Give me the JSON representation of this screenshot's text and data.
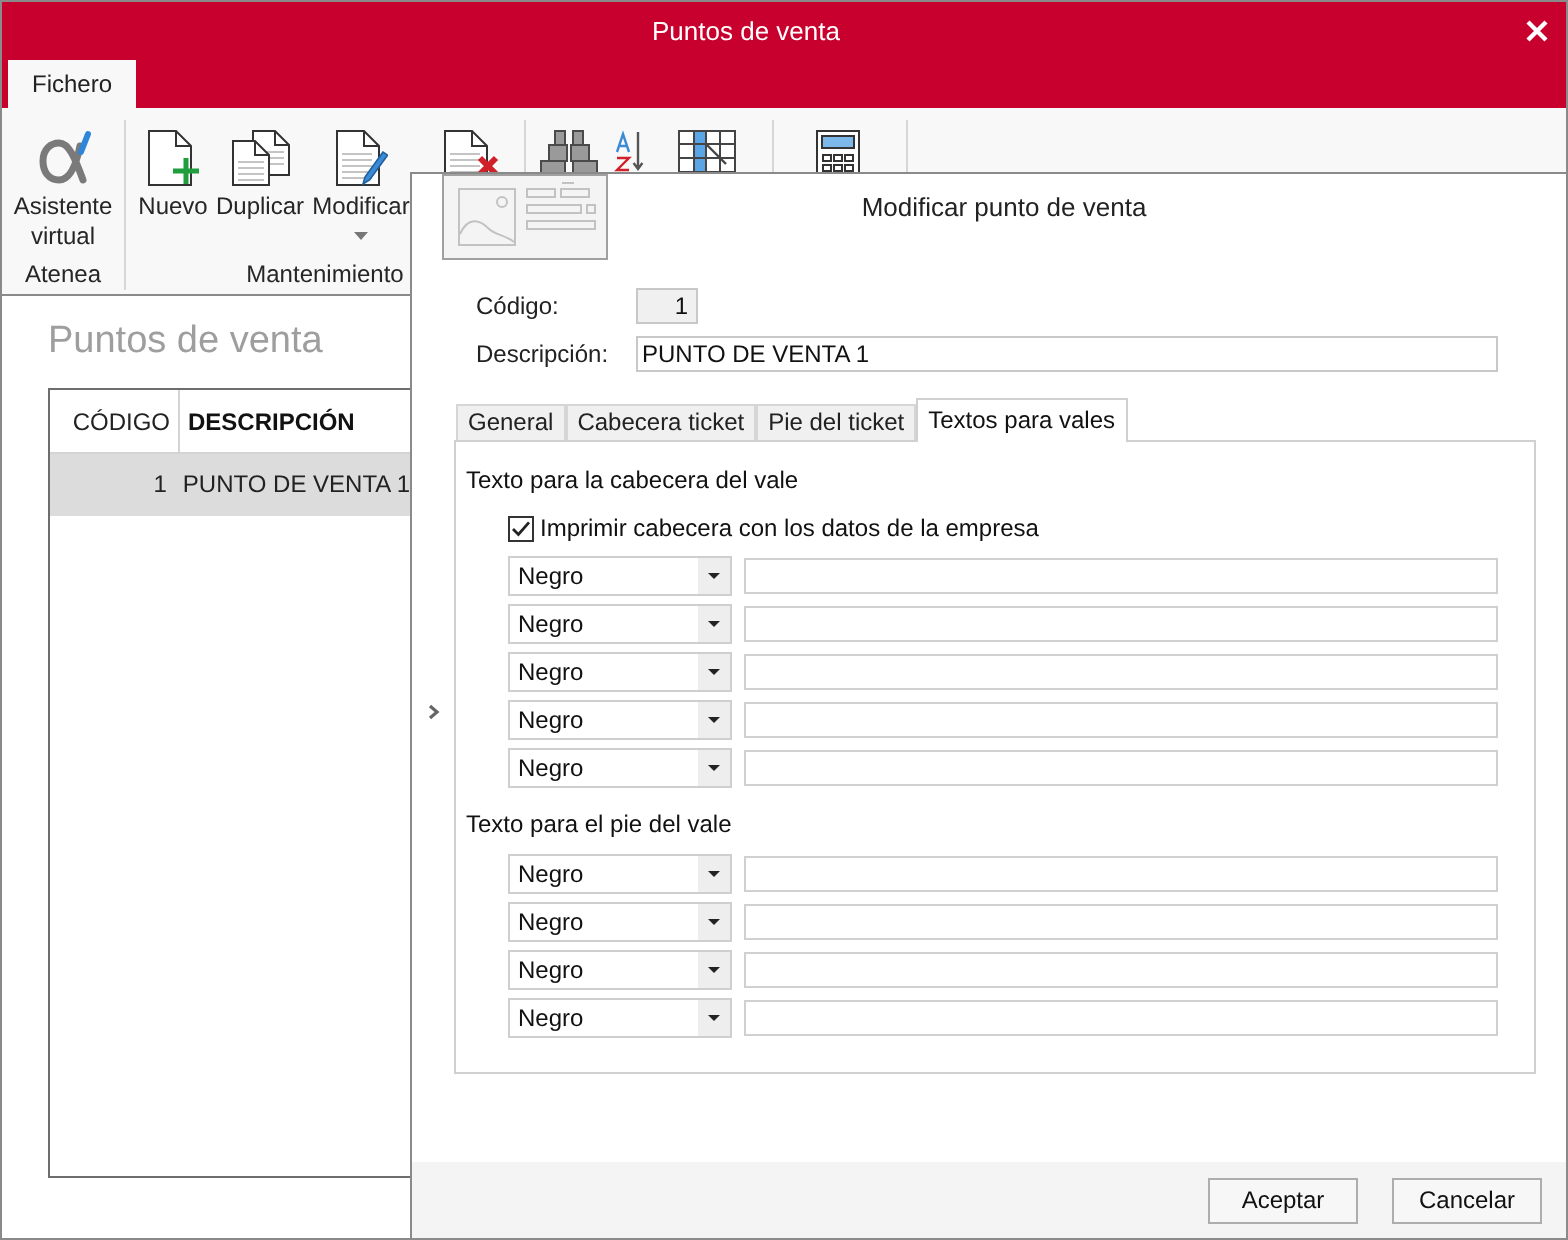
{
  "window": {
    "title": "Puntos de venta"
  },
  "ribbon_tabs": [
    {
      "label": "Fichero",
      "selected": true
    }
  ],
  "ribbon_groups": [
    {
      "label": "Atenea",
      "buttons": [
        {
          "kind": "alpha",
          "label": "Asistente virtual",
          "dropdown": false
        }
      ]
    },
    {
      "label": "Mantenimiento",
      "buttons": [
        {
          "kind": "new",
          "label": "Nuevo",
          "dropdown": false
        },
        {
          "kind": "duplicate",
          "label": "Duplicar",
          "dropdown": false
        },
        {
          "kind": "edit",
          "label": "Modificar",
          "dropdown": true
        },
        {
          "kind": "delete"
        }
      ]
    },
    {
      "buttons": [
        {
          "kind": "search"
        },
        {
          "kind": "sort"
        },
        {
          "kind": "columns"
        }
      ]
    },
    {
      "buttons": [
        {
          "kind": "calculator"
        }
      ]
    }
  ],
  "list": {
    "heading": "Puntos de venta",
    "columns": [
      {
        "label": "CÓDIGO",
        "sorted": false
      },
      {
        "label": "DESCRIPCIÓN",
        "sorted": true
      }
    ],
    "rows": [
      {
        "cells": [
          "1",
          "PUNTO DE VENTA 1"
        ],
        "selected": true
      }
    ]
  },
  "dialog": {
    "title": "Modificar punto de venta",
    "fields": [
      {
        "kind": "readonly",
        "label": "Código:",
        "value": "1"
      },
      {
        "kind": "text",
        "label": "Descripción:",
        "value": "PUNTO DE VENTA 1"
      }
    ],
    "tabs": [
      {
        "label": "General",
        "selected": false
      },
      {
        "label": "Cabecera ticket",
        "selected": false
      },
      {
        "label": "Pie del ticket",
        "selected": false
      },
      {
        "label": "Textos para vales",
        "selected": true
      }
    ],
    "sections": [
      {
        "heading": "Texto para la cabecera del vale",
        "checkbox": {
          "label": "Imprimir cabecera con los datos de la empresa",
          "checked": true
        },
        "lines": [
          {
            "select": "Negro"
          },
          {
            "select": "Negro"
          },
          {
            "select": "Negro"
          },
          {
            "select": "Negro"
          },
          {
            "select": "Negro"
          }
        ]
      },
      {
        "heading": "Texto para el pie del vale",
        "lines": [
          {
            "select": "Negro"
          },
          {
            "select": "Negro"
          },
          {
            "select": "Negro"
          },
          {
            "select": "Negro"
          }
        ]
      }
    ],
    "buttons": [
      "Aceptar",
      "Cancelar"
    ]
  }
}
